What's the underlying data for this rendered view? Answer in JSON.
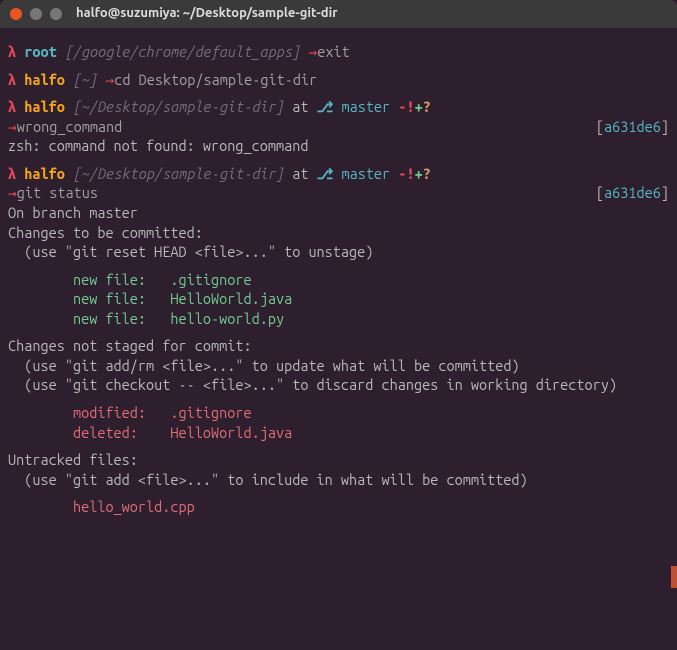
{
  "window": {
    "title": "halfo@suzumiya: ~/Desktop/sample-git-dir"
  },
  "prompt1": {
    "lambda": "λ",
    "user": "root",
    "path": "[/google/chrome/default_apps]",
    "arrow": "→",
    "cmd": "exit"
  },
  "prompt2": {
    "lambda": "λ",
    "user": "halfo",
    "path": "[~]",
    "arrow": "→",
    "cmd": "cd Desktop/sample-git-dir"
  },
  "prompt3": {
    "lambda": "λ",
    "user": "halfo",
    "path": "[~/Desktop/sample-git-dir]",
    "at": "at",
    "branch_glyph": "⎇",
    "branch": "master",
    "flags_minus": "-",
    "flags_bang": "!",
    "flags_plus": "+",
    "flags_ques": "?",
    "arrow": "→",
    "cmd": "wrong_command",
    "hash_l": "[",
    "hash": "a631de6",
    "hash_r": "]",
    "error": "zsh: command not found: wrong_command"
  },
  "prompt4": {
    "lambda": "λ",
    "user": "halfo",
    "path": "[~/Desktop/sample-git-dir]",
    "at": "at",
    "branch_glyph": "⎇",
    "branch": "master",
    "flags_minus": "-",
    "flags_bang": "!",
    "flags_plus": "+",
    "flags_ques": "?",
    "arrow": "→",
    "cmd": "git status",
    "hash_l": "[",
    "hash": "a631de6",
    "hash_r": "]"
  },
  "gitstatus": {
    "on_branch": "On branch master",
    "to_commit_hdr": "Changes to be committed:",
    "to_commit_hint": "  (use \"git reset HEAD <file>...\" to unstage)",
    "nf1": "        new file:   .gitignore",
    "nf2": "        new file:   HelloWorld.java",
    "nf3": "        new file:   hello-world.py",
    "not_staged_hdr": "Changes not staged for commit:",
    "not_staged_hint1": "  (use \"git add/rm <file>...\" to update what will be committed)",
    "not_staged_hint2": "  (use \"git checkout -- <file>...\" to discard changes in working directory)",
    "mod1": "        modified:   .gitignore",
    "del1": "        deleted:    HelloWorld.java",
    "untracked_hdr": "Untracked files:",
    "untracked_hint": "  (use \"git add <file>...\" to include in what will be committed)",
    "ut1": "        hello_world.cpp"
  }
}
